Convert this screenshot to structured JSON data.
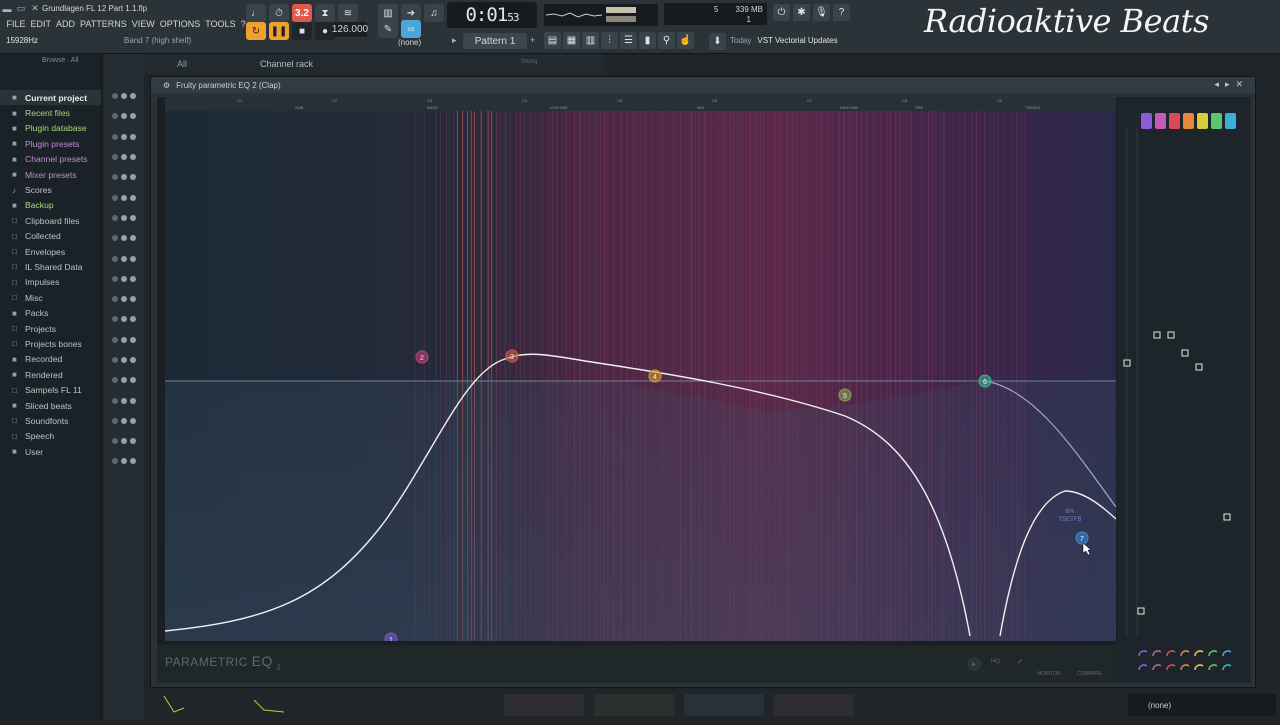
{
  "window": {
    "file_title": "Grundlagen FL 12 Part 1.1.flp",
    "hint_value": "15928Hz",
    "hint_label": "Band 7 (high shelf)"
  },
  "menu": [
    "FILE",
    "EDIT",
    "ADD",
    "PATTERNS",
    "VIEW",
    "OPTIONS",
    "TOOLS",
    "?"
  ],
  "transport": {
    "time": "0:01",
    "time_small": "53",
    "tempo": "126.000",
    "pattern": "Pattern 1",
    "selector": "(none)",
    "pat_button": "3.2"
  },
  "cpu": {
    "voices": "5",
    "memory": "339 MB",
    "poly": "1"
  },
  "news": {
    "label": "Today",
    "text": "VST Vectorial Updates"
  },
  "brand": "Radioaktive Beats",
  "browser": {
    "header": "Browse . All",
    "items": [
      {
        "label": "Current project",
        "icon": "■",
        "style": "sel"
      },
      {
        "label": "Recent files",
        "icon": "■",
        "style": "green"
      },
      {
        "label": "Plugin database",
        "icon": "■",
        "style": "green"
      },
      {
        "label": "Plugin presets",
        "icon": "■",
        "style": "purple"
      },
      {
        "label": "Channel presets",
        "icon": "■",
        "style": "purple"
      },
      {
        "label": "Mixer presets",
        "icon": "■",
        "style": "purple"
      },
      {
        "label": "Scores",
        "icon": "♪",
        "style": ""
      },
      {
        "label": "Backup",
        "icon": "■",
        "style": "green"
      },
      {
        "label": "Clipboard files",
        "icon": "□",
        "style": ""
      },
      {
        "label": "Collected",
        "icon": "□",
        "style": ""
      },
      {
        "label": "Envelopes",
        "icon": "□",
        "style": ""
      },
      {
        "label": "IL Shared Data",
        "icon": "□",
        "style": ""
      },
      {
        "label": "Impulses",
        "icon": "□",
        "style": ""
      },
      {
        "label": "Misc",
        "icon": "□",
        "style": ""
      },
      {
        "label": "Packs",
        "icon": "■",
        "style": ""
      },
      {
        "label": "Projects",
        "icon": "□",
        "style": ""
      },
      {
        "label": "Projects bones",
        "icon": "□",
        "style": ""
      },
      {
        "label": "Recorded",
        "icon": "■",
        "style": ""
      },
      {
        "label": "Rendered",
        "icon": "■",
        "style": ""
      },
      {
        "label": "Sampels FL 11",
        "icon": "□",
        "style": ""
      },
      {
        "label": "Sliced beats",
        "icon": "■",
        "style": ""
      },
      {
        "label": "Soundfonts",
        "icon": "□",
        "style": ""
      },
      {
        "label": "Speech",
        "icon": "□",
        "style": ""
      },
      {
        "label": "User",
        "icon": "■",
        "style": ""
      }
    ]
  },
  "channel_rack": {
    "filter": "All",
    "title": "Channel rack",
    "swing": "Swing"
  },
  "eq": {
    "window_title": "Fruity parametric EQ 2 (Clap)",
    "logo": "PARAMETRIC",
    "logo_eq": "EQ",
    "logo_sub": "2",
    "bands_header": [
      "C1",
      "C2",
      "C3",
      "C4",
      "C5",
      "C6",
      "C7",
      "C8",
      "C9"
    ],
    "bands_header2": [
      "SUB",
      "BASS",
      "LOW MID",
      "MID",
      "HIGH MID",
      "PRE",
      "TREBLE"
    ],
    "band_tooltip": [
      "6%",
      "TSETFB"
    ],
    "band_colors": [
      "#8e5bd6",
      "#c45ab8",
      "#d84a5a",
      "#e8863a",
      "#d8cc3a",
      "#5ac870",
      "#3ab0d8"
    ],
    "bottom_labels": {
      "hq": "HQ",
      "monitor": "MONITOR",
      "compare": "COMPARE"
    },
    "bands": [
      {
        "id": 1,
        "label": "1",
        "color": "#7a56c8"
      },
      {
        "id": 2,
        "label": "2",
        "color": "#c0407a"
      },
      {
        "id": 3,
        "label": "3",
        "color": "#d05a44"
      },
      {
        "id": 4,
        "label": "4",
        "color": "#d49a2e"
      },
      {
        "id": 5,
        "label": "5",
        "color": "#8aa04a"
      },
      {
        "id": 6,
        "label": "6",
        "color": "#3cb48a"
      },
      {
        "id": 7,
        "label": "7",
        "color": "#3a8ad0"
      }
    ]
  },
  "status": {
    "none_label": "(none)"
  }
}
